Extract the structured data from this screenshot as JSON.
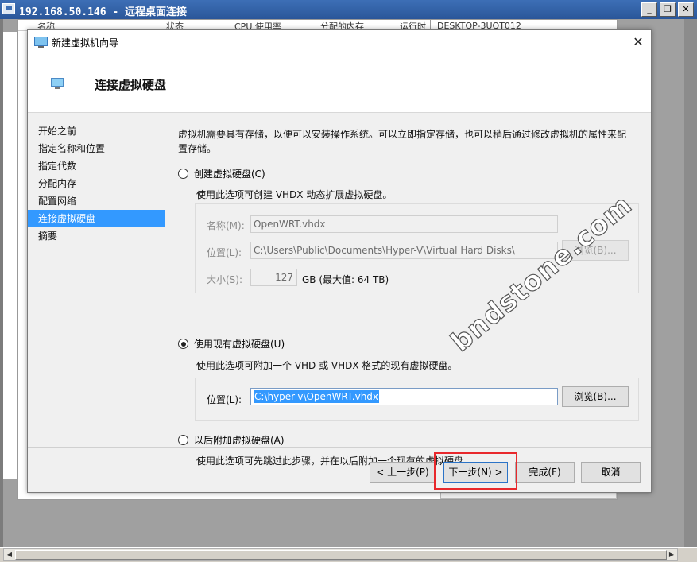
{
  "rdp": {
    "title": "192.168.50.146 - 远程桌面连接",
    "minimize": "_",
    "restore": "❐",
    "close": "✕"
  },
  "taskmgr": {
    "headers": [
      "名称",
      "状态",
      "CPU 使用率",
      "分配的内存",
      "运行时"
    ],
    "desktop_label": "DESKTOP-3UQT012"
  },
  "wizard": {
    "window_title": "新建虚拟机向导",
    "close_glyph": "✕",
    "heading": "连接虚拟硬盘",
    "nav": [
      "开始之前",
      "指定名称和位置",
      "指定代数",
      "分配内存",
      "配置网络",
      "连接虚拟硬盘",
      "摘要"
    ],
    "selected_nav_index": 5,
    "description": "虚拟机需要具有存储，以便可以安装操作系统。可以立即指定存储，也可以稍后通过修改虚拟机的属性来配置存储。",
    "option_create": {
      "label": "创建虚拟硬盘(C)",
      "note": "使用此选项可创建 VHDX 动态扩展虚拟硬盘。",
      "name_label": "名称(M):",
      "name_value": "OpenWRT.vhdx",
      "location_label": "位置(L):",
      "location_value": "C:\\Users\\Public\\Documents\\Hyper-V\\Virtual Hard Disks\\",
      "browse_label": "浏览(B)...",
      "size_label": "大小(S):",
      "size_value": "127",
      "size_unit": "GB (最大值: 64 TB)"
    },
    "option_existing": {
      "label": "使用现有虚拟硬盘(U)",
      "note": "使用此选项可附加一个 VHD 或 VHDX 格式的现有虚拟硬盘。",
      "location_label": "位置(L):",
      "location_value": "C:\\hyper-v\\OpenWRT.vhdx",
      "browse_label": "浏览(B)..."
    },
    "option_later": {
      "label": "以后附加虚拟硬盘(A)",
      "note": "使用此选项可先跳过此步骤，并在以后附加一个现有的虚拟硬盘。"
    },
    "selected_option": "existing",
    "buttons": {
      "prev": "< 上一步(P)",
      "next": "下一步(N) >",
      "finish": "完成(F)",
      "cancel": "取消"
    }
  },
  "watermark": "bndstone.com",
  "colors": {
    "selection": "#3399ff",
    "annotation_box": "#e8282c"
  }
}
